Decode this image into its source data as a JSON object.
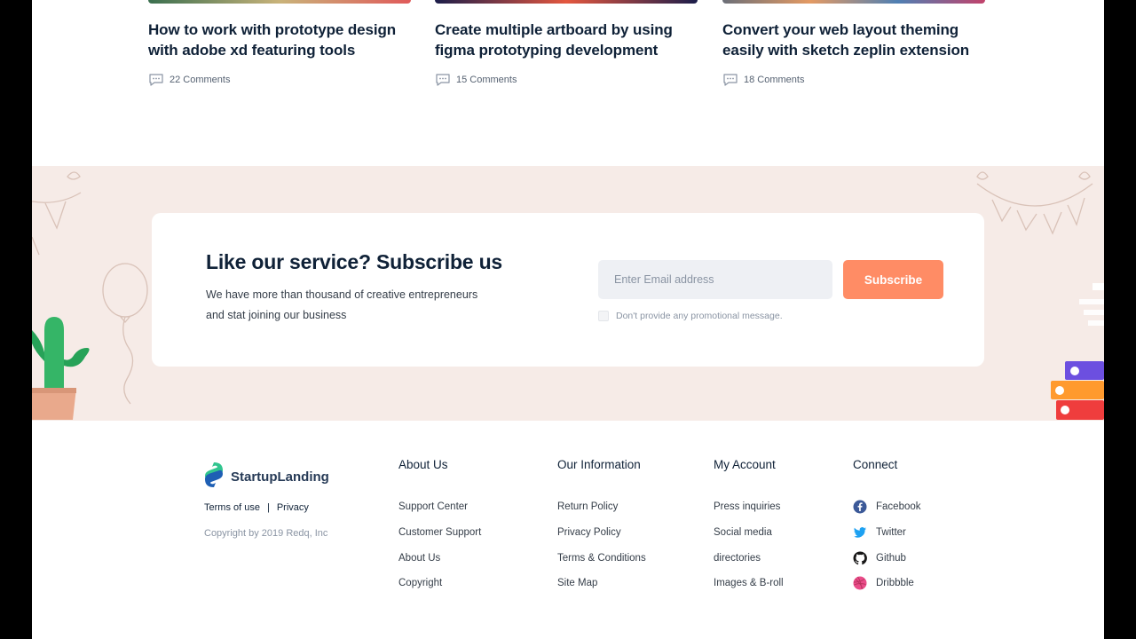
{
  "blog": {
    "cards": [
      {
        "title": "How to work with prototype design with adobe xd featuring tools",
        "comments": "22 Comments"
      },
      {
        "title": "Create multiple artboard by using figma prototyping development",
        "comments": "15 Comments"
      },
      {
        "title": "Convert your web layout theming easily with sketch zeplin extension",
        "comments": "18 Comments"
      }
    ]
  },
  "subscribe": {
    "title": "Like our service? Subscribe us",
    "text": "We have more than thousand of creative entrepreneurs and stat joining our business",
    "email_placeholder": "Enter Email address",
    "button_label": "Subscribe",
    "checkbox_label": "Don't provide any promotional message."
  },
  "footer": {
    "brand": "StartupLanding",
    "terms": "Terms of use",
    "separator": "|",
    "privacy": "Privacy",
    "copyright": "Copyright by 2019 Redq, Inc",
    "columns": [
      {
        "title": "About Us",
        "items": [
          "Support Center",
          "Customer Support",
          "About Us",
          "Copyright"
        ]
      },
      {
        "title": "Our Information",
        "items": [
          "Return Policy",
          "Privacy Policy",
          "Terms & Conditions",
          "Site Map"
        ]
      },
      {
        "title": "My Account",
        "items": [
          "Press inquiries",
          "Social media",
          "directories",
          "Images & B-roll"
        ]
      },
      {
        "title": "Connect",
        "items": [
          "Facebook",
          "Twitter",
          "Github",
          "Dribbble"
        ]
      }
    ]
  },
  "colors": {
    "accent": "#ff8c65",
    "band": "#f6ebe7",
    "heading": "#0f2137"
  },
  "icons": [
    "comment-icon",
    "facebook-icon",
    "twitter-icon",
    "github-icon",
    "dribbble-icon"
  ]
}
